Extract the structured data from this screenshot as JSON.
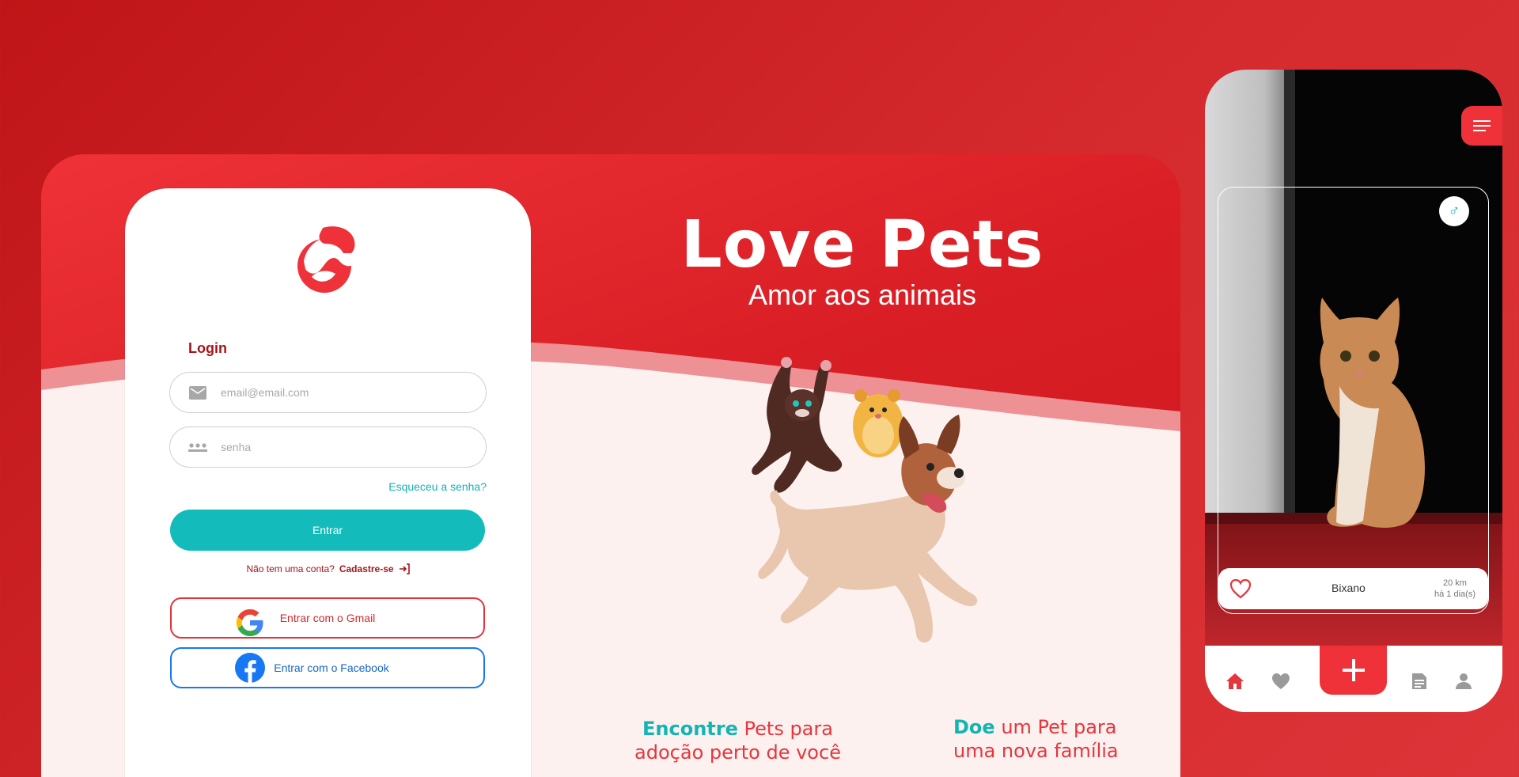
{
  "colors": {
    "brand_red": "#e5363c",
    "dark_red": "#a8141a",
    "teal": "#13bcba",
    "facebook_blue": "#1877f2"
  },
  "hero": {
    "title": "Love Pets",
    "subtitle": "Amor aos animais"
  },
  "login": {
    "title": "Login",
    "email_placeholder": "email@email.com",
    "email_icon": "mail-icon",
    "password_placeholder": "senha",
    "password_icon": "password-dots-icon",
    "forgot_label": "Esqueceu a senha?",
    "enter_label": "Entrar",
    "no_account_text": "Não tem uma conta?",
    "signup_label": "Cadastre-se",
    "google_label": "Entrar com o Gmail",
    "facebook_label": "Entrar com o Facebook"
  },
  "taglines": {
    "find_accent": "Encontre",
    "find_rest": " Pets para adoção perto de você",
    "donate_accent": "Doe",
    "donate_rest": " um Pet para uma nova família"
  },
  "phone": {
    "gender_symbol": "♂",
    "pet_name": "Bixano",
    "distance": "20 km",
    "posted": "há 1 dia(s)",
    "nav_items": [
      "home-icon",
      "heart-icon",
      "add-icon",
      "document-icon",
      "profile-icon"
    ]
  }
}
